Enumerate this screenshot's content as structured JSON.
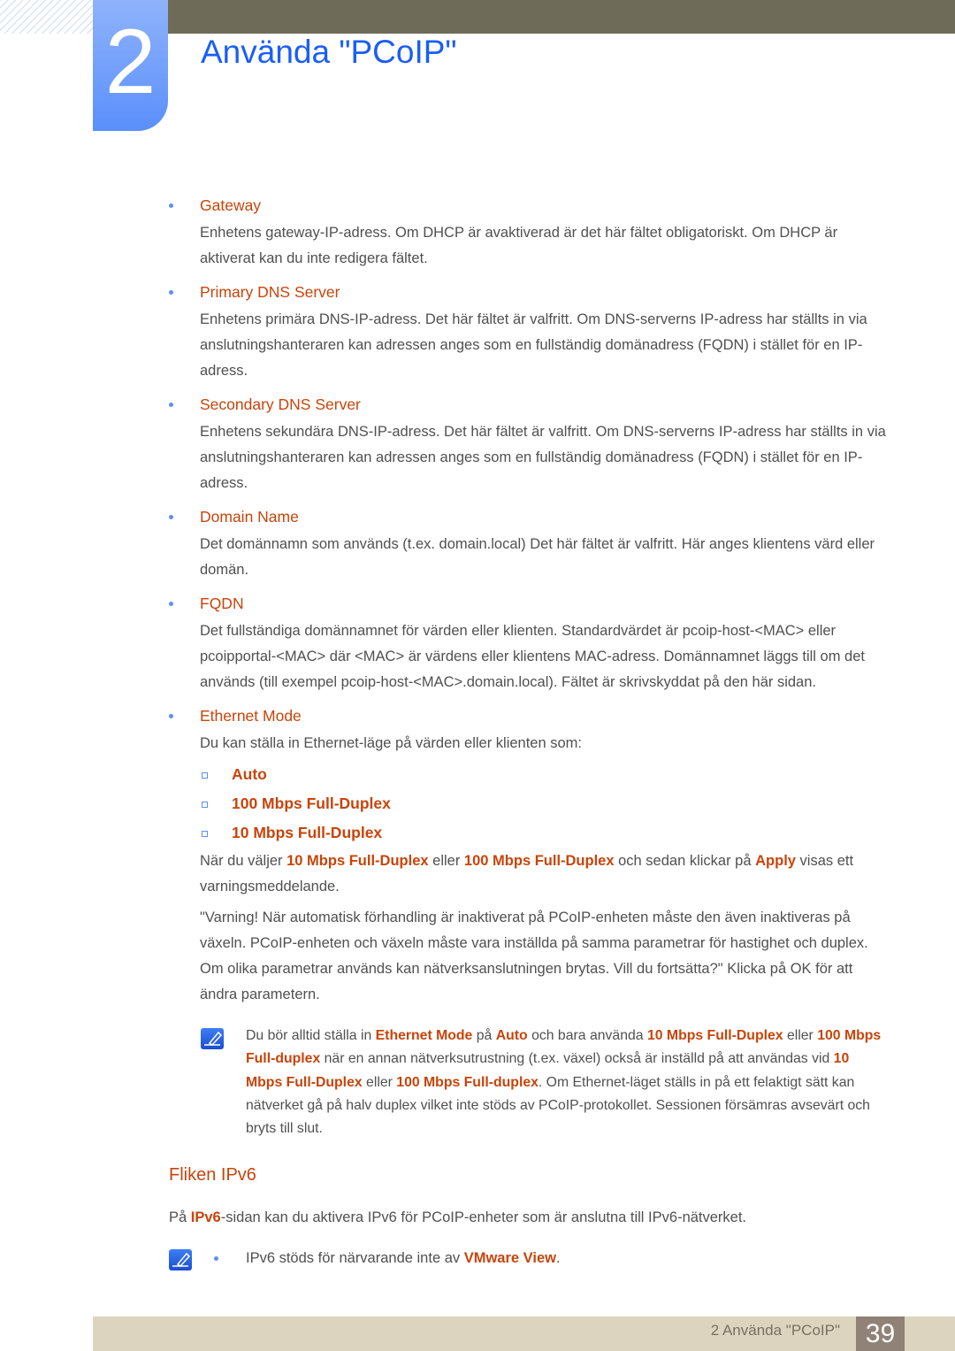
{
  "header": {
    "chapter_number": "2",
    "title": "Använda \"PCoIP\""
  },
  "items": [
    {
      "heading": "Gateway",
      "text": [
        {
          "t": "Enhetens gateway-IP-adress. Om DHCP är avaktiverad är det här fältet obligatoriskt. Om DHCP är aktiverat kan du inte redigera fältet."
        }
      ]
    },
    {
      "heading": "Primary DNS Server",
      "text": [
        {
          "t": "Enhetens primära DNS-IP-adress. Det här fältet är valfritt. Om DNS-serverns IP-adress har ställts in via anslutningshanteraren kan adressen anges som en fullständig domänadress (FQDN) i stället för en IP-adress."
        }
      ]
    },
    {
      "heading": "Secondary DNS Server",
      "text": [
        {
          "t": "Enhetens sekundära DNS-IP-adress. Det här fältet är valfritt. Om DNS-serverns IP-adress har ställts in via anslutningshanteraren kan adressen anges som en fullständig domänadress (FQDN) i stället för en IP-adress."
        }
      ]
    },
    {
      "heading": "Domain Name",
      "text": [
        {
          "t": "Det domännamn som används (t.ex. domain.local) Det här fältet är valfritt. Här anges klientens värd eller domän."
        }
      ]
    },
    {
      "heading": "FQDN",
      "text": [
        {
          "t": "Det fullständiga domännamnet för värden eller klienten. Standardvärdet är pcoip-host-<MAC> eller pcoipportal-<MAC> där <MAC> är värdens eller klientens MAC-adress. Domännamnet läggs till om det används (till exempel pcoip-host-<MAC>.domain.local). Fältet är skrivskyddat på den här sidan."
        }
      ]
    },
    {
      "heading": "Ethernet Mode",
      "text": [
        {
          "t": "Du kan ställa in Ethernet-läge på värden eller klienten som:"
        }
      ]
    }
  ],
  "ethernet_options": [
    "Auto",
    "100 Mbps Full-Duplex",
    "10 Mbps Full-Duplex"
  ],
  "after_options": [
    [
      {
        "t": "När du väljer "
      },
      {
        "t": "10 Mbps Full-Duplex",
        "b": 1
      },
      {
        "t": " eller "
      },
      {
        "t": "100 Mbps Full-Duplex",
        "b": 1
      },
      {
        "t": " och sedan klickar på "
      },
      {
        "t": "Apply",
        "b": 1
      },
      {
        "t": " visas ett varningsmeddelande."
      }
    ],
    [
      {
        "t": "\"Varning! När automatisk förhandling är inaktiverat på PCoIP-enheten måste den även inaktiveras på växeln. PCoIP-enheten och växeln måste vara inställda på samma parametrar för hastighet och duplex. Om olika parametrar används kan nätverksanslutningen brytas. Vill du fortsätta?\" Klicka på OK för att ändra parametern."
      }
    ]
  ],
  "note1": [
    {
      "t": "Du bör alltid ställa in "
    },
    {
      "t": "Ethernet Mode",
      "b": 1
    },
    {
      "t": " på "
    },
    {
      "t": "Auto",
      "b": 1
    },
    {
      "t": " och bara använda "
    },
    {
      "t": "10 Mbps Full-Duplex",
      "b": 1
    },
    {
      "t": " eller "
    },
    {
      "t": "100 Mbps Full-duplex",
      "b": 1
    },
    {
      "t": " när en annan nätverksutrustning (t.ex. växel) också är inställd på att användas vid "
    },
    {
      "t": "10 Mbps Full-Duplex",
      "b": 1
    },
    {
      "t": " eller "
    },
    {
      "t": "100 Mbps Full-duplex",
      "b": 1
    },
    {
      "t": ". Om Ethernet-läget ställs in på ett felaktigt sätt kan nätverket gå på halv duplex vilket inte stöds av PCoIP-protokollet. Sessionen försämras avsevärt och bryts till slut."
    }
  ],
  "section2": {
    "heading": "Fliken IPv6",
    "text": [
      {
        "t": "På "
      },
      {
        "t": "IPv6",
        "b": 1
      },
      {
        "t": "-sidan kan du aktivera IPv6 för PCoIP-enheter som är anslutna till IPv6-nätverket."
      }
    ],
    "note": [
      {
        "t": "IPv6 stöds för närvarande inte av "
      },
      {
        "t": "VMware View",
        "b": 1
      },
      {
        "t": "."
      }
    ]
  },
  "footer": {
    "chapter_label": "2 Använda \"PCoIP\"",
    "page_number": "39"
  },
  "colors": {
    "accent": "#c8440a",
    "title_blue": "#1a5ef5",
    "topbar": "#6e6b58",
    "footer": "#dcd4bf"
  }
}
